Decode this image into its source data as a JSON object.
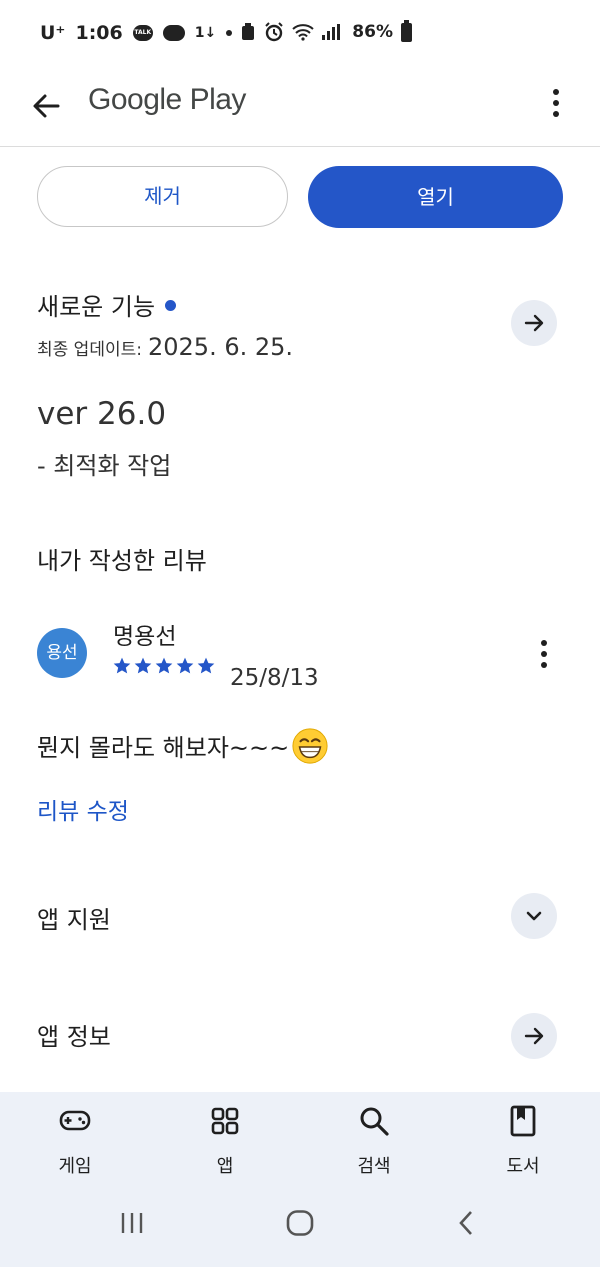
{
  "status_bar": {
    "carrier": "U⁺",
    "time": "1:06",
    "talk_badge": "TALK",
    "network_label": "1↓",
    "battery_percent": "86%"
  },
  "header": {
    "title": "Google Play"
  },
  "actions": {
    "remove_label": "제거",
    "open_label": "열기"
  },
  "whats_new": {
    "title": "새로운 기능",
    "updated_prefix": "최종 업데이트:",
    "updated_date": "2025. 6. 25.",
    "version": "ver 26.0",
    "note": "- 최적화 작업"
  },
  "my_review": {
    "section_title": "내가 작성한 리뷰",
    "avatar_text": "용선",
    "reviewer_name": "명용선",
    "rating": 5,
    "date": "25/8/13",
    "text": "뭔지 몰라도 해보자~~~",
    "edit_label": "리뷰 수정"
  },
  "app_support": {
    "title": "앱 지원"
  },
  "app_info": {
    "title": "앱 정보"
  },
  "bottom_nav": {
    "games": "게임",
    "apps": "앱",
    "search": "검색",
    "books": "도서"
  },
  "colors": {
    "accent": "#2456c8",
    "link": "#1e56c7",
    "avatar_bg": "#3a84d4",
    "nav_bg": "#edf1f8"
  },
  "icons": [
    "back-arrow-icon",
    "more-vert-icon",
    "arrow-right-icon",
    "chevron-down-icon",
    "star-icon",
    "grin-emoji-icon",
    "gamepad-icon",
    "apps-grid-icon",
    "search-icon",
    "book-icon"
  ]
}
